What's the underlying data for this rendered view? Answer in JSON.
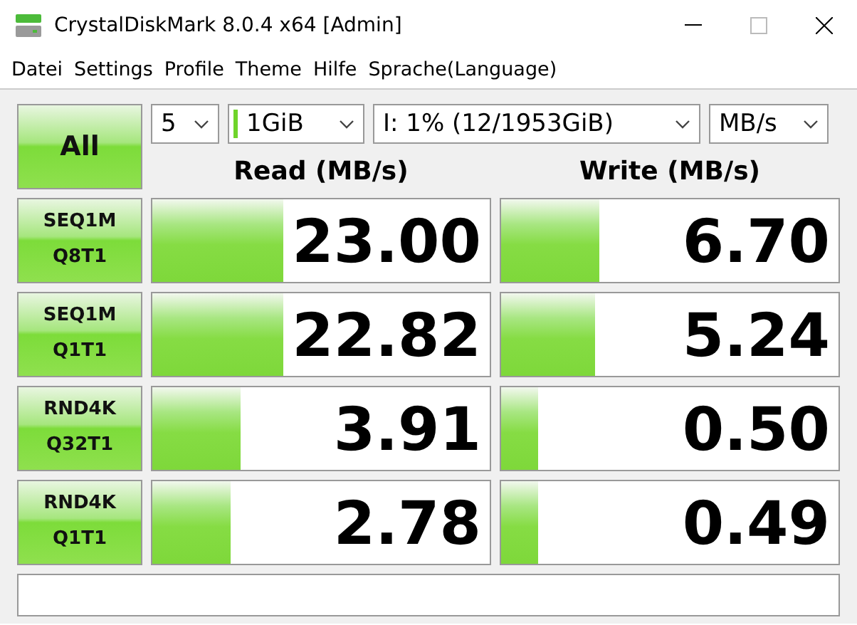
{
  "window": {
    "title": "CrystalDiskMark 8.0.4 x64 [Admin]"
  },
  "menu": [
    "Datei",
    "Settings",
    "Profile",
    "Theme",
    "Hilfe",
    "Sprache(Language)"
  ],
  "all_button": "All",
  "selectors": [
    {
      "value": "5"
    },
    {
      "value": "1GiB"
    },
    {
      "value": "I: 1% (12/1953GiB)"
    },
    {
      "value": "MB/s"
    }
  ],
  "headers": {
    "read": "Read (MB/s)",
    "write": "Write (MB/s)"
  },
  "tests": [
    {
      "line1": "SEQ1M",
      "line2": "Q8T1",
      "read": {
        "value": "23.00",
        "level": 0.39
      },
      "write": {
        "value": "6.70",
        "level": 0.29
      }
    },
    {
      "line1": "SEQ1M",
      "line2": "Q1T1",
      "read": {
        "value": "22.82",
        "level": 0.39
      },
      "write": {
        "value": "5.24",
        "level": 0.28
      }
    },
    {
      "line1": "RND4K",
      "line2": "Q32T1",
      "read": {
        "value": "3.91",
        "level": 0.26
      },
      "write": {
        "value": "0.50",
        "level": 0.11
      }
    },
    {
      "line1": "RND4K",
      "line2": "Q1T1",
      "read": {
        "value": "2.78",
        "level": 0.23
      },
      "write": {
        "value": "0.49",
        "level": 0.11
      }
    }
  ]
}
